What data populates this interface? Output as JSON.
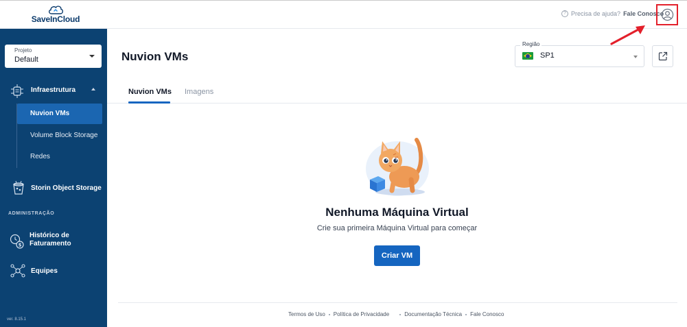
{
  "header": {
    "logo_text": "SaveInCloud",
    "help_text": "Precisa de ajuda?",
    "help_link": "Fale Conosco",
    "user_icon": "user-circle-icon"
  },
  "sidebar": {
    "project": {
      "label": "Projeto",
      "value": "Default"
    },
    "infra": {
      "label": "Infraestrutura",
      "expanded": true
    },
    "sub_items": [
      {
        "label": "Nuvion VMs",
        "active": true
      },
      {
        "label": "Volume Block Storage",
        "active": false
      },
      {
        "label": "Redes",
        "active": false
      }
    ],
    "storin": {
      "label": "Storin Object Storage"
    },
    "section_admin": "ADMINISTRAÇÃO",
    "billing": {
      "line1": "Histórico de",
      "line2": "Faturamento"
    },
    "teams": {
      "label": "Equipes"
    },
    "version": "ver. 8.15.1"
  },
  "main": {
    "title": "Nuvion VMs",
    "region": {
      "label": "Região",
      "value": "SP1",
      "flag": "brazil-flag"
    },
    "tabs": [
      {
        "label": "Nuvion VMs",
        "active": true
      },
      {
        "label": "Imagens",
        "active": false
      }
    ],
    "empty": {
      "title": "Nenhuma Máquina Virtual",
      "subtitle": "Crie sua primeira Máquina Virtual para começar",
      "button": "Criar VM"
    }
  },
  "footer": {
    "links": [
      "Termos de Uso",
      "Política de Privacidade",
      "Documentação Técnica",
      "Fale Conosco"
    ]
  },
  "colors": {
    "sidebar_bg": "#0c4272",
    "accent": "#1565c0",
    "highlight": "#e3202b"
  }
}
